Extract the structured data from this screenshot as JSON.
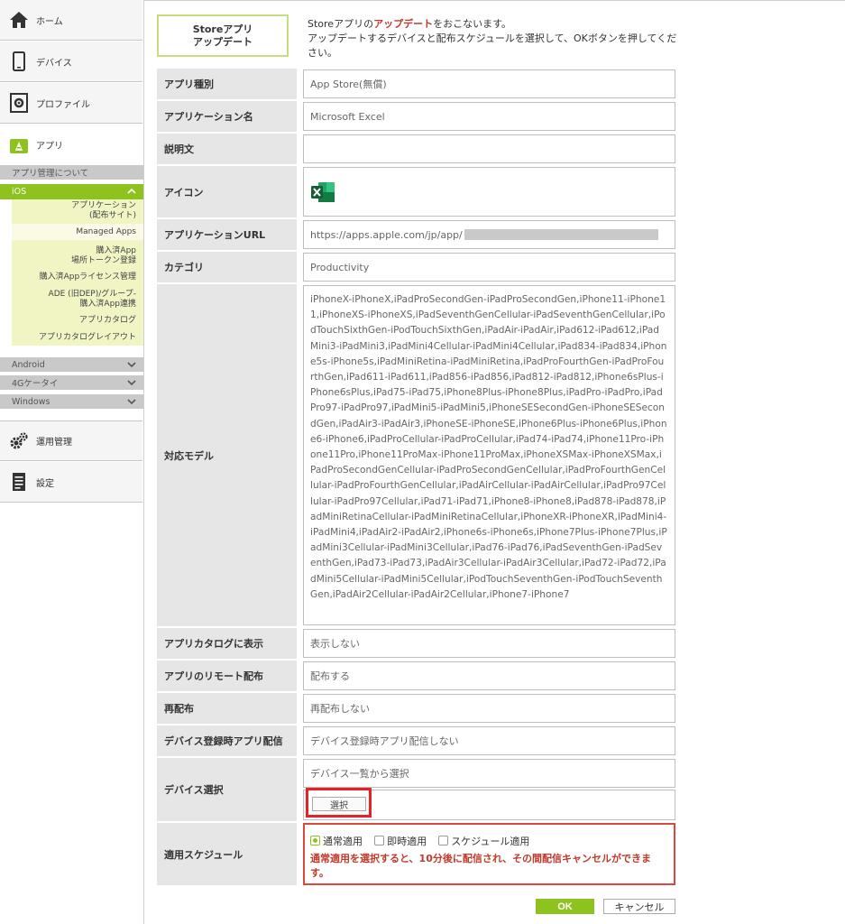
{
  "sidebar": {
    "home": "ホーム",
    "device": "デバイス",
    "profile": "プロファイル",
    "app": "アプリ",
    "about_app": "アプリ管理について",
    "ios": "iOS",
    "ios_items": [
      "アプリケーション\n(配布サイト)",
      "Managed Apps",
      "購入済App\n場所トークン登録",
      "購入済Appライセンス管理",
      "ADE (旧DEP)/グループ-\n購入済App連携",
      "アプリカタログ",
      "アプリカタログレイアウト"
    ],
    "android": "Android",
    "keitai": "4Gケータイ",
    "windows": "Windows",
    "operation": "運用管理",
    "settings": "設定"
  },
  "header": {
    "title_line1": "Storeアプリ",
    "title_line2": "アップデート",
    "desc_pre": "Storeアプリの",
    "desc_hl": "アップデート",
    "desc_post": "をおこないます。",
    "desc_line2": "アップデートするデバイスと配布スケジュールを選択して、OKボタンを押してください。"
  },
  "form": {
    "app_type_label": "アプリ種別",
    "app_type_value": "App Store(無償)",
    "app_name_label": "アプリケーション名",
    "app_name_value": "Microsoft Excel",
    "description_label": "説明文",
    "description_value": "",
    "icon_label": "アイコン",
    "url_label": "アプリケーションURL",
    "url_value": "https://apps.apple.com/jp/app/",
    "category_label": "カテゴリ",
    "category_value": "Productivity",
    "models_label": "対応モデル",
    "models_value": "iPhoneX-iPhoneX,iPadProSecondGen-iPadProSecondGen,iPhone11-iPhone11,iPhoneXS-iPhoneXS,iPadSeventhGenCellular-iPadSeventhGenCellular,iPodTouchSixthGen-iPodTouchSixthGen,iPadAir-iPadAir,iPad612-iPad612,iPadMini3-iPadMini3,iPadMini4Cellular-iPadMini4Cellular,iPad834-iPad834,iPhone5s-iPhone5s,iPadMiniRetina-iPadMiniRetina,iPadProFourthGen-iPadProFourthGen,iPad611-iPad611,iPad856-iPad856,iPad812-iPad812,iPhone6sPlus-iPhone6sPlus,iPad75-iPad75,iPhone8Plus-iPhone8Plus,iPadPro-iPadPro,iPadPro97-iPadPro97,iPadMini5-iPadMini5,iPhoneSESecondGen-iPhoneSESecondGen,iPadAir3-iPadAir3,iPhoneSE-iPhoneSE,iPhone6Plus-iPhone6Plus,iPhone6-iPhone6,iPadProCellular-iPadProCellular,iPad74-iPad74,iPhone11Pro-iPhone11Pro,iPhone11ProMax-iPhone11ProMax,iPhoneXSMax-iPhoneXSMax,iPadProSecondGenCellular-iPadProSecondGenCellular,iPadProFourthGenCellular-iPadProFourthGenCellular,iPadAirCellular-iPadAirCellular,iPadPro97Cellular-iPadPro97Cellular,iPad71-iPad71,iPhone8-iPhone8,iPad878-iPad878,iPadMiniRetinaCellular-iPadMiniRetinaCellular,iPhoneXR-iPhoneXR,iPadMini4-iPadMini4,iPadAir2-iPadAir2,iPhone6s-iPhone6s,iPhone7Plus-iPhone7Plus,iPadMini3Cellular-iPadMini3Cellular,iPad76-iPad76,iPadSeventhGen-iPadSeventhGen,iPad73-iPad73,iPadAir3Cellular-iPadAir3Cellular,iPad72-iPad72,iPadMini5Cellular-iPadMini5Cellular,iPodTouchSeventhGen-iPodTouchSeventhGen,iPadAir2Cellular-iPadAir2Cellular,iPhone7-iPhone7",
    "catalog_label": "アプリカタログに表示",
    "catalog_value": "表示しない",
    "remote_label": "アプリのリモート配布",
    "remote_value": "配布する",
    "redist_label": "再配布",
    "redist_value": "再配布しない",
    "devreg_label": "デバイス登録時アプリ配信",
    "devreg_value": "デバイス登録時アプリ配信しない",
    "devsel_label": "デバイス選択",
    "devsel_placeholder": "デバイス一覧から選択",
    "select_button": "選択",
    "schedule_label": "適用スケジュール",
    "schedule_options": [
      "通常適用",
      "即時適用",
      "スケジュール適用"
    ],
    "schedule_note": "通常適用を選択すると、10分後に配信され、その間配信キャンセルができます。"
  },
  "buttons": {
    "ok": "OK",
    "cancel": "キャンセル"
  },
  "colors": {
    "accent": "#8dc21f",
    "highlight_red": "#e8202a",
    "warn_text": "#c0392b"
  }
}
